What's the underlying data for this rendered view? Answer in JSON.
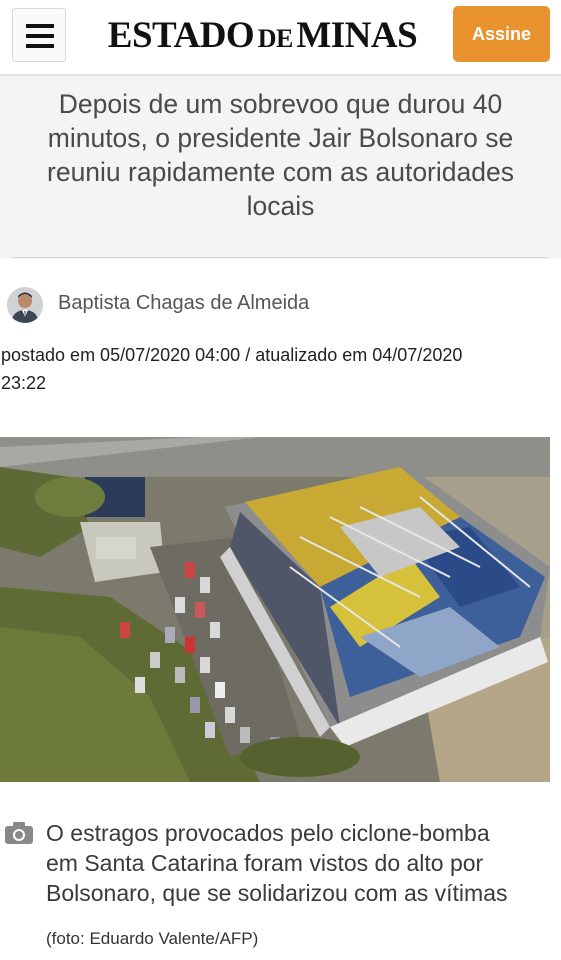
{
  "header": {
    "logo_part1": "ESTADO",
    "logo_part2": "DE",
    "logo_part3": "MINAS",
    "subscribe_label": "Assine",
    "menu_icon": "hamburger-menu-icon",
    "accent_color": "#e8932e"
  },
  "article": {
    "subtitle": "Depois de um sobrevoo que durou 40 minutos, o presidente Jair Bolsonaro se reuniu rapidamente com as autoridades locais",
    "author": "Baptista Chagas de Almeida",
    "dates_line1": "postado em 05/07/2020 04:00 / atualizado em 04/07/2020",
    "dates_line2": "23:22",
    "caption_line1": "O estragos provocados pelo ciclone-bomba",
    "caption_line2": "em Santa Catarina foram vistos do alto por",
    "caption_line3": "Bolsonaro, que se solidarizou com as vítimas",
    "photo_credit": "(foto: Eduardo Valente/AFP)",
    "caption_icon": "camera-icon"
  }
}
